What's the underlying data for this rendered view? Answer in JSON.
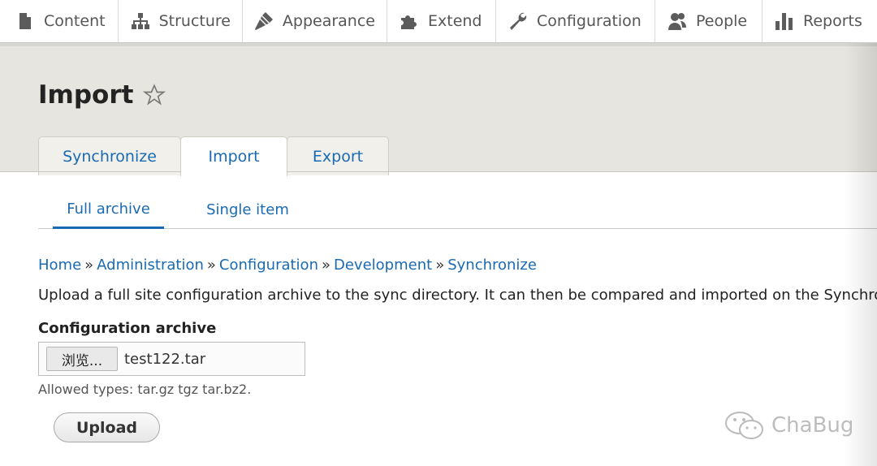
{
  "toolbar": {
    "items": [
      {
        "label": "Content",
        "icon": "content-icon"
      },
      {
        "label": "Structure",
        "icon": "structure-icon"
      },
      {
        "label": "Appearance",
        "icon": "appearance-icon"
      },
      {
        "label": "Extend",
        "icon": "extend-icon"
      },
      {
        "label": "Configuration",
        "icon": "configuration-icon"
      },
      {
        "label": "People",
        "icon": "people-icon"
      },
      {
        "label": "Reports",
        "icon": "reports-icon"
      }
    ]
  },
  "page": {
    "title": "Import",
    "tabs": [
      "Synchronize",
      "Import",
      "Export"
    ],
    "active_tab": "Import",
    "subtabs": [
      "Full archive",
      "Single item"
    ],
    "active_subtab": "Full archive"
  },
  "breadcrumb": [
    "Home",
    "Administration",
    "Configuration",
    "Development",
    "Synchronize"
  ],
  "breadcrumb_separator": "»",
  "description": "Upload a full site configuration archive to the sync directory. It can then be compared and imported on the Synchroniz",
  "form": {
    "label": "Configuration archive",
    "browse_label": "浏览...",
    "file_name": "test122.tar",
    "help": "Allowed types: tar.gz tgz tar.bz2.",
    "submit_label": "Upload"
  },
  "watermark": {
    "text": "ChaBug"
  },
  "colors": {
    "link": "#1a6ab3",
    "header_bg": "#e6e5df",
    "toolbar_text": "#565656"
  }
}
